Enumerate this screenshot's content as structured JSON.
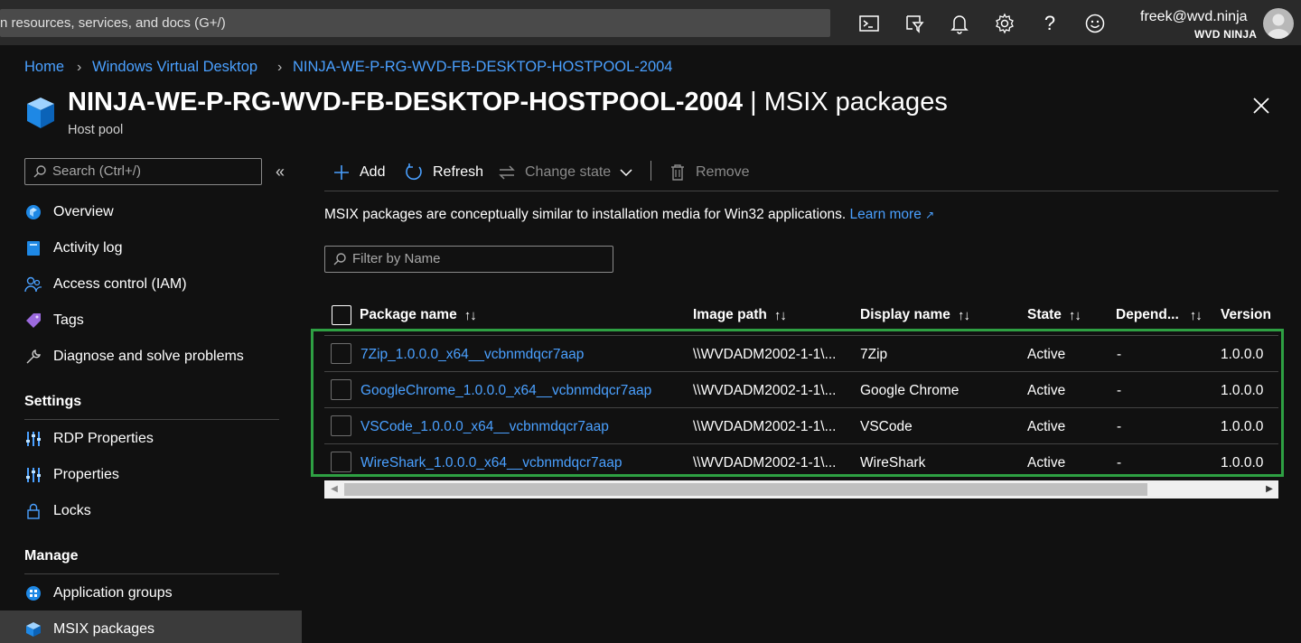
{
  "topbar": {
    "search_text": "n resources, services, and docs (G+/)",
    "user_name": "freek@wvd.ninja",
    "user_org": "WVD NINJA"
  },
  "breadcrumb": [
    "Home",
    "Windows Virtual Desktop",
    "NINJA-WE-P-RG-WVD-FB-DESKTOP-HOSTPOOL-2004"
  ],
  "header": {
    "resource_name": "NINJA-WE-P-RG-WVD-FB-DESKTOP-HOSTPOOL-2004",
    "separator": " | ",
    "blade_name": "MSIX packages",
    "subtitle": "Host pool"
  },
  "sidebar": {
    "search_placeholder": "Search (Ctrl+/)",
    "items": [
      {
        "label": "Overview"
      },
      {
        "label": "Activity log"
      },
      {
        "label": "Access control (IAM)"
      },
      {
        "label": "Tags"
      },
      {
        "label": "Diagnose and solve problems"
      }
    ],
    "settings_heading": "Settings",
    "settings_items": [
      {
        "label": "RDP Properties"
      },
      {
        "label": "Properties"
      },
      {
        "label": "Locks"
      }
    ],
    "manage_heading": "Manage",
    "manage_items": [
      {
        "label": "Application groups"
      },
      {
        "label": "MSIX packages"
      }
    ]
  },
  "toolbar": {
    "add": "Add",
    "refresh": "Refresh",
    "change_state": "Change state",
    "remove": "Remove"
  },
  "description": {
    "text": "MSIX packages are conceptually similar to installation media for Win32 applications.",
    "link": "Learn more"
  },
  "filter": {
    "placeholder": "Filter by Name"
  },
  "table": {
    "columns": [
      "Package name",
      "Image path",
      "Display name",
      "State",
      "Depend...",
      "Version"
    ],
    "rows": [
      {
        "package": "7Zip_1.0.0.0_x64__vcbnmdqcr7aap",
        "path": "\\\\WVDADM2002-1-1\\...",
        "display": "7Zip",
        "state": "Active",
        "depend": "-",
        "version": "1.0.0.0"
      },
      {
        "package": "GoogleChrome_1.0.0.0_x64__vcbnmdqcr7aap",
        "path": "\\\\WVDADM2002-1-1\\...",
        "display": "Google Chrome",
        "state": "Active",
        "depend": "-",
        "version": "1.0.0.0"
      },
      {
        "package": "VSCode_1.0.0.0_x64__vcbnmdqcr7aap",
        "path": "\\\\WVDADM2002-1-1\\...",
        "display": "VSCode",
        "state": "Active",
        "depend": "-",
        "version": "1.0.0.0"
      },
      {
        "package": "WireShark_1.0.0.0_x64__vcbnmdqcr7aap",
        "path": "\\\\WVDADM2002-1-1\\...",
        "display": "WireShark",
        "state": "Active",
        "depend": "-",
        "version": "1.0.0.0"
      }
    ]
  },
  "colors": {
    "background": "#111111",
    "topbar": "#2a2a2a",
    "link": "#4aa0ff",
    "highlight": "#2ea043"
  }
}
